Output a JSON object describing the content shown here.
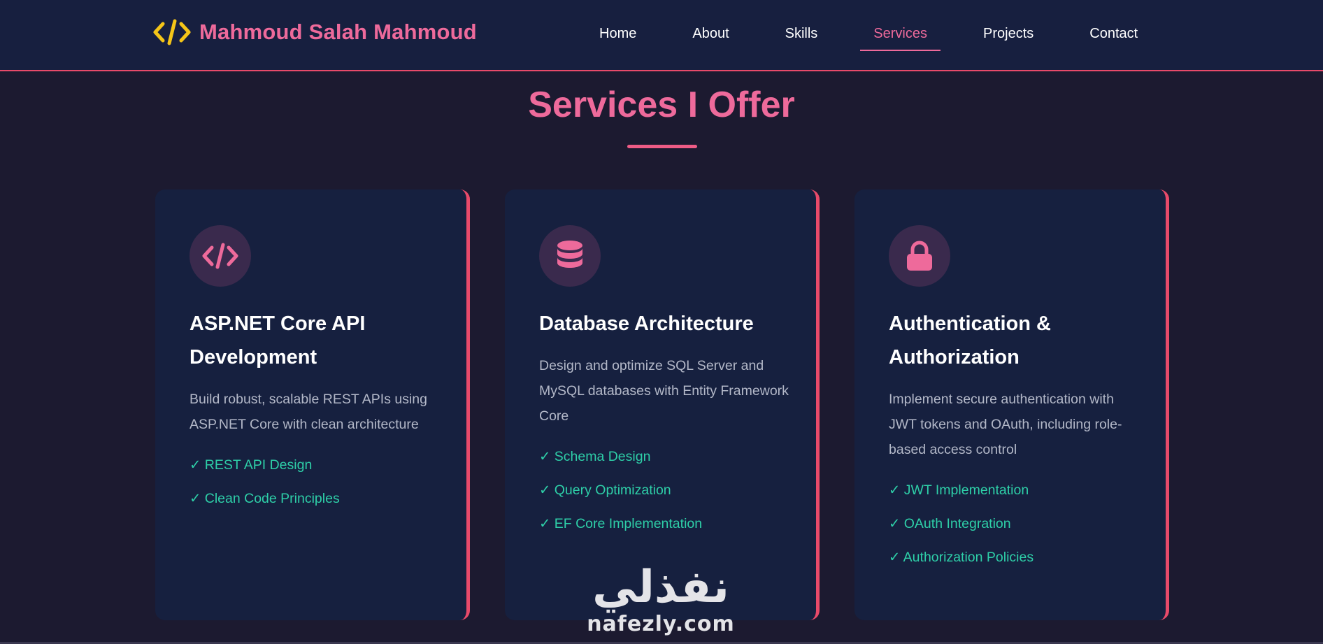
{
  "header": {
    "brand_icon": "code-brackets-icon",
    "brand_name": "Mahmoud Salah Mahmoud",
    "nav": [
      {
        "label": "Home",
        "active": false
      },
      {
        "label": "About",
        "active": false
      },
      {
        "label": "Skills",
        "active": false
      },
      {
        "label": "Services",
        "active": true
      },
      {
        "label": "Projects",
        "active": false
      },
      {
        "label": "Contact",
        "active": false
      }
    ]
  },
  "section": {
    "title": "Services I Offer"
  },
  "cards": [
    {
      "icon": "code-icon",
      "title": "ASP.NET Core API Development",
      "description": "Build robust, scalable REST APIs using ASP.NET Core with clean architecture",
      "features": [
        "✓ REST API Design",
        "✓ Clean Code Principles"
      ]
    },
    {
      "icon": "database-icon",
      "title": "Database Architecture",
      "description": "Design and optimize SQL Server and MySQL databases with Entity Framework Core",
      "features": [
        "✓ Schema Design",
        "✓ Query Optimization",
        "✓ EF Core Implementation"
      ]
    },
    {
      "icon": "lock-icon",
      "title": "Authentication & Authorization",
      "description": "Implement secure authentication with JWT tokens and OAuth, including role-based access control",
      "features": [
        "✓ JWT Implementation",
        "✓ OAuth Integration",
        "✓ Authorization Policies"
      ]
    }
  ],
  "watermark": {
    "arabic": "نفذلي",
    "latin": "nafezly.com"
  },
  "colors": {
    "accent_pink": "#ee6a9b",
    "accent_red": "#e84a6a",
    "feature_green": "#2ecfa8",
    "brand_icon_yellow": "#f5c518",
    "header_bg": "#171f3f",
    "card_bg": "#16203f",
    "page_bg": "#1c1a30"
  }
}
